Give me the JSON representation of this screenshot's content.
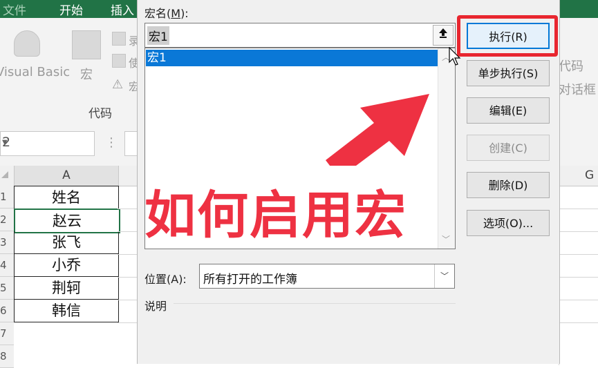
{
  "excel": {
    "tabs": [
      "文件",
      "开始",
      "插入"
    ],
    "ribbon": {
      "visual_basic_label": "Visual Basic",
      "macros_label": "宏",
      "group_label": "代码",
      "partial_right_1": "代码",
      "partial_right_2": "对话框",
      "partial_left_small_1": "录",
      "partial_left_small_2": "使",
      "partial_left_small_3": "宏"
    },
    "name_box": "2",
    "columns": [
      "A",
      "G"
    ],
    "row_numbers": [
      "1",
      "2",
      "3",
      "4",
      "5",
      "6",
      "7",
      "8"
    ],
    "cells": [
      "姓名",
      "赵云",
      "张飞",
      "小乔",
      "荆轲",
      "韩信"
    ]
  },
  "dialog": {
    "macro_name_label": "宏名(",
    "macro_name_key": "M",
    "macro_name_label_end": "):",
    "macro_name_value": "宏1",
    "upload_icon": "upload-arrow-icon",
    "macro_list": [
      "宏1"
    ],
    "overlay_text": "如何启用宏",
    "buttons": {
      "run": "执行(R)",
      "step_into": "单步执行(S)",
      "edit": "编辑(E)",
      "create": "创建(C)",
      "delete": "删除(D)",
      "options": "选项(O)..."
    },
    "location_label": "位置(A):",
    "location_value": "所有打开的工作簿",
    "description_label": "说明"
  },
  "colors": {
    "excel_green": "#217346",
    "selection_blue": "#0a78d7",
    "highlight_red": "#e8262f",
    "overlay_red": "#ee3142"
  }
}
